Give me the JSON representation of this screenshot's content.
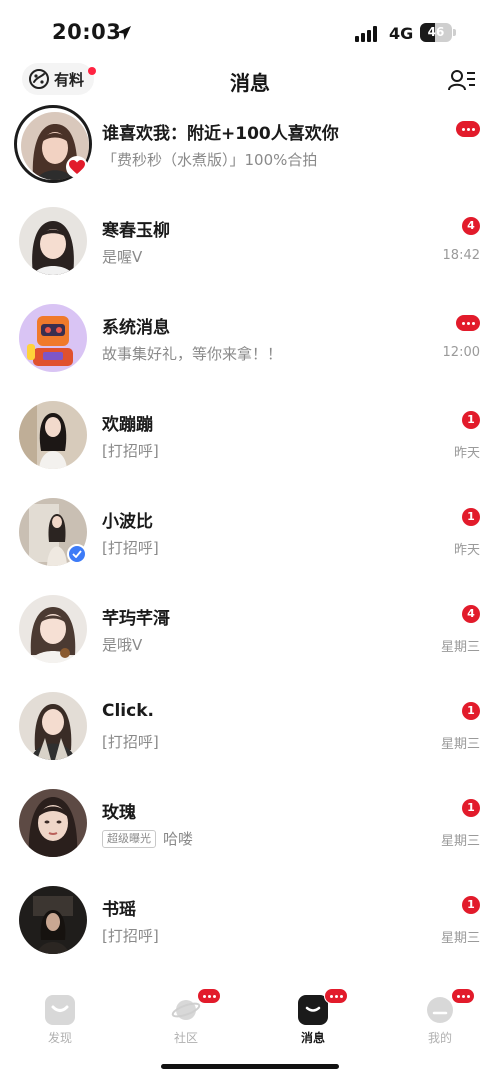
{
  "status_bar": {
    "time": "20:03",
    "network": "4G",
    "battery": "46",
    "battery_level": 0.46
  },
  "header": {
    "youliao_label": "有料",
    "title": "消息",
    "contacts_icon": "contacts-icon"
  },
  "messages": [
    {
      "name": "谁喜欢我：附近+100人喜欢你",
      "preview": "「费秒秒（水煮版）」100%合拍",
      "time": "",
      "badge": "dots",
      "tag": ""
    },
    {
      "name": "寒春玉柳",
      "preview": "是喔V",
      "time": "18:42",
      "badge": "4",
      "tag": ""
    },
    {
      "name": "系统消息",
      "preview": "故事集好礼，等你来拿！！",
      "time": "12:00",
      "badge": "dots",
      "tag": ""
    },
    {
      "name": "欢蹦蹦",
      "preview": "[打招呼]",
      "time": "昨天",
      "badge": "1",
      "tag": ""
    },
    {
      "name": "小波比",
      "preview": "[打招呼]",
      "time": "昨天",
      "badge": "1",
      "tag": ""
    },
    {
      "name": "芊玙芊滒",
      "preview": "是哦V",
      "time": "星期三",
      "badge": "4",
      "tag": ""
    },
    {
      "name": "Click.",
      "preview": "[打招呼]",
      "time": "星期三",
      "badge": "1",
      "tag": ""
    },
    {
      "name": "玫瑰",
      "preview": "哈喽",
      "time": "星期三",
      "badge": "1",
      "tag": "超级曝光"
    },
    {
      "name": "书瑶",
      "preview": "[打招呼]",
      "time": "星期三",
      "badge": "1",
      "tag": ""
    }
  ],
  "tabs": [
    {
      "label": "发现",
      "icon": "discover-icon",
      "badge": false,
      "active": false
    },
    {
      "label": "社区",
      "icon": "planet-icon",
      "badge": true,
      "active": false
    },
    {
      "label": "消息",
      "icon": "chat-bubble-icon",
      "badge": true,
      "active": true
    },
    {
      "label": "我的",
      "icon": "profile-icon",
      "badge": true,
      "active": false
    }
  ],
  "colors": {
    "accent_red": "#e21b2b",
    "text_primary": "#1a1a1a",
    "text_secondary": "#8a8a8a"
  }
}
